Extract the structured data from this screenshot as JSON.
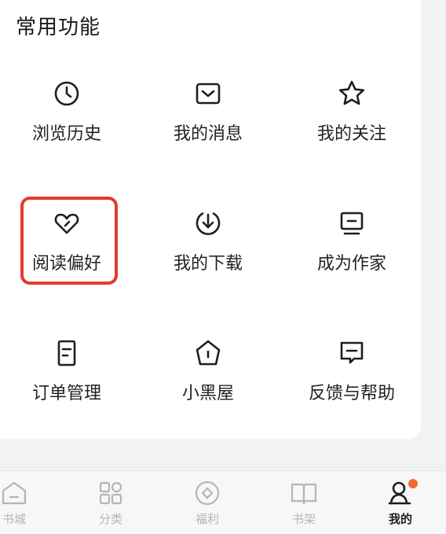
{
  "section": {
    "title": "常用功能"
  },
  "functions": [
    {
      "label": "浏览历史",
      "icon": "clock-icon"
    },
    {
      "label": "我的消息",
      "icon": "message-icon"
    },
    {
      "label": "我的关注",
      "icon": "star-icon"
    },
    {
      "label": "阅读偏好",
      "icon": "heart-icon",
      "highlighted": true
    },
    {
      "label": "我的下载",
      "icon": "download-icon"
    },
    {
      "label": "成为作家",
      "icon": "monitor-icon"
    },
    {
      "label": "订单管理",
      "icon": "order-icon"
    },
    {
      "label": "小黑屋",
      "icon": "house-icon"
    },
    {
      "label": "反馈与帮助",
      "icon": "feedback-icon"
    }
  ],
  "tabbar": [
    {
      "label": "书城",
      "icon": "home-icon"
    },
    {
      "label": "分类",
      "icon": "grid-icon"
    },
    {
      "label": "福利",
      "icon": "gift-icon"
    },
    {
      "label": "书架",
      "icon": "book-icon"
    },
    {
      "label": "我的",
      "icon": "profile-icon",
      "active": true,
      "badge": true
    }
  ],
  "colors": {
    "highlight": "#e23b2e",
    "badge": "#f06a32",
    "inactive_tab": "#b5b5b5"
  }
}
